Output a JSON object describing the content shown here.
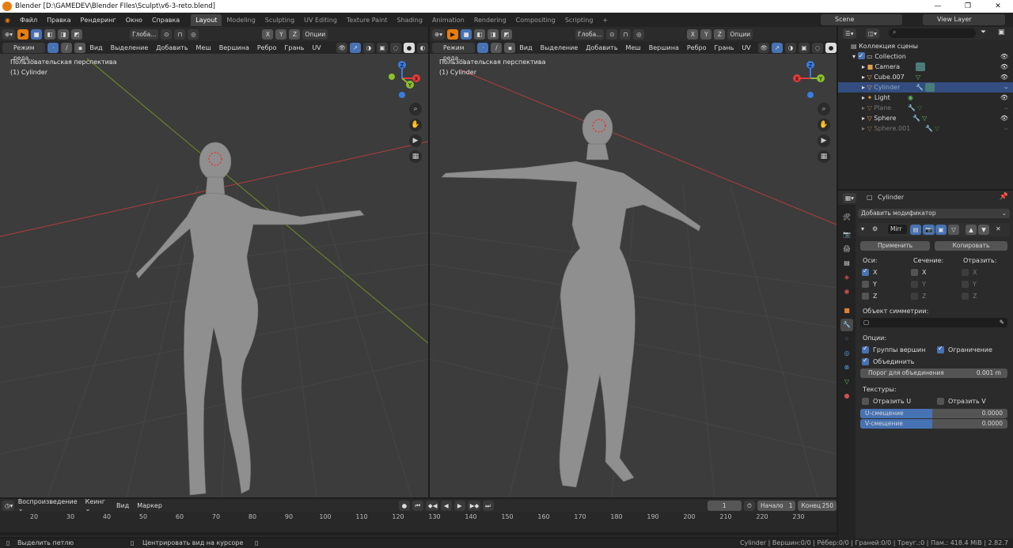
{
  "window": {
    "title": "Blender [D:\\GAMEDEV\\Blender FIles\\Sculpt\\v6-3-reto.blend]"
  },
  "menu": [
    "Файл",
    "Правка",
    "Рендеринг",
    "Окно",
    "Справка"
  ],
  "workspaces": [
    "Layout",
    "Modeling",
    "Sculpting",
    "UV Editing",
    "Texture Paint",
    "Shading",
    "Animation",
    "Rendering",
    "Compositing",
    "Scripting"
  ],
  "scene": {
    "name": "Scene",
    "view_layer": "View Layer"
  },
  "viewport": {
    "orientation": "Глоба...",
    "axes": [
      "X",
      "Y",
      "Z"
    ],
    "options": "Опции",
    "mode": "Режим реда...",
    "mode_short": "Режим реда...",
    "menus": [
      "Вид",
      "Выделение",
      "Добавить",
      "Меш",
      "Вершина",
      "Ребро",
      "Грань",
      "UV"
    ],
    "perspective": "Пользовательская перспектива",
    "object": "(1) Cylinder",
    "gizmo": {
      "x": "X",
      "y": "Y",
      "z": "Z"
    }
  },
  "outliner": {
    "search_placeholder": "",
    "root": "Коллекция сцены",
    "collection": "Collection",
    "items": [
      {
        "name": "Camera"
      },
      {
        "name": "Cube.007"
      },
      {
        "name": "Cylinder"
      },
      {
        "name": "Light"
      },
      {
        "name": "Plane"
      },
      {
        "name": "Sphere"
      },
      {
        "name": "Sphere.001"
      }
    ]
  },
  "properties": {
    "object_name": "Cylinder",
    "add_modifier": "Добавить модификатор",
    "modifier_name": "Mirr",
    "apply": "Применить",
    "copy": "Копировать",
    "axis_label": "Оси:",
    "bisect_label": "Сечение:",
    "flip_label": "Отразить:",
    "axes": [
      "X",
      "Y",
      "Z"
    ],
    "mirror_object_label": "Объект симметрии:",
    "options_label": "Опции:",
    "vertex_groups": "Группы вершин",
    "clipping": "Ограничение",
    "merge": "Объединить",
    "merge_threshold_label": "Порог для объединения",
    "merge_threshold_value": "0.001 m",
    "textures_label": "Текстуры:",
    "flip_u": "Отразить U",
    "flip_v": "Отразить V",
    "u_offset_label": "U-смещение",
    "u_offset_value": "0.0000",
    "v_offset_label": "V-смещение",
    "v_offset_value": "0.0000"
  },
  "timeline": {
    "playback": "Воспроизведение",
    "keying": "Кеинг",
    "view": "Вид",
    "marker": "Маркер",
    "current_frame": "1",
    "start_label": "Начало",
    "start": "1",
    "end_label": "Конец",
    "end": "250",
    "ticks": [
      "20",
      "30",
      "40",
      "50",
      "60",
      "70",
      "80",
      "90",
      "100",
      "110",
      "120",
      "130",
      "140",
      "150",
      "160",
      "170",
      "180",
      "190",
      "200",
      "210",
      "220",
      "230"
    ]
  },
  "status": {
    "left1": "Выделить петлю",
    "left2": "Центрировать вид на курсоре",
    "right": "Cylinder | Вершин:0/0 | Рёбер:0/0 | Граней:0/0 | Треуг.:0 | Пам.: 418.4 MiB | 2.82.7"
  },
  "colors": {
    "accent": "#4772b3",
    "x_axis": "#e23b3b",
    "y_axis": "#8bbf2f",
    "z_axis": "#3a7be0",
    "viewport_bg": "#3c3c3c"
  }
}
